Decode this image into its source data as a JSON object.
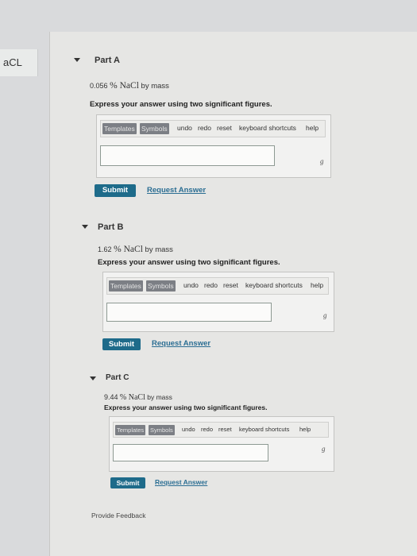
{
  "sidebar": {
    "label": "aCL"
  },
  "parts": [
    {
      "header": "Part A",
      "value": "0.056",
      "chem": "% NaCl",
      "suffix": "by mass",
      "instruction": "Express your answer using two significant figures.",
      "toolbar": {
        "templates": "Templates",
        "symbols": "Symbols",
        "undo": "undo",
        "redo": "redo",
        "reset": "reset",
        "shortcuts": "keyboard shortcuts",
        "help": "help"
      },
      "answer": "",
      "unit": "g",
      "submit": "Submit",
      "request": "Request Answer"
    },
    {
      "header": "Part B",
      "value": "1.62",
      "chem": "% NaCl",
      "suffix": "by mass",
      "instruction": "Express your answer using two significant figures.",
      "toolbar": {
        "templates": "Templates",
        "symbols": "Symbols",
        "undo": "undo",
        "redo": "redo",
        "reset": "reset",
        "shortcuts": "keyboard shortcuts",
        "help": "help"
      },
      "answer": "",
      "unit": "g",
      "submit": "Submit",
      "request": "Request Answer"
    },
    {
      "header": "Part C",
      "value": "9.44",
      "chem": "% NaCl",
      "suffix": "by mass",
      "instruction": "Express your answer using two significant figures.",
      "toolbar": {
        "templates": "Templates",
        "symbols": "Symbols",
        "undo": "undo",
        "redo": "redo",
        "reset": "reset",
        "shortcuts": "keyboard shortcuts",
        "help": "help"
      },
      "answer": "",
      "unit": "g",
      "submit": "Submit",
      "request": "Request Answer"
    }
  ],
  "footer": {
    "feedback": "Provide Feedback"
  }
}
